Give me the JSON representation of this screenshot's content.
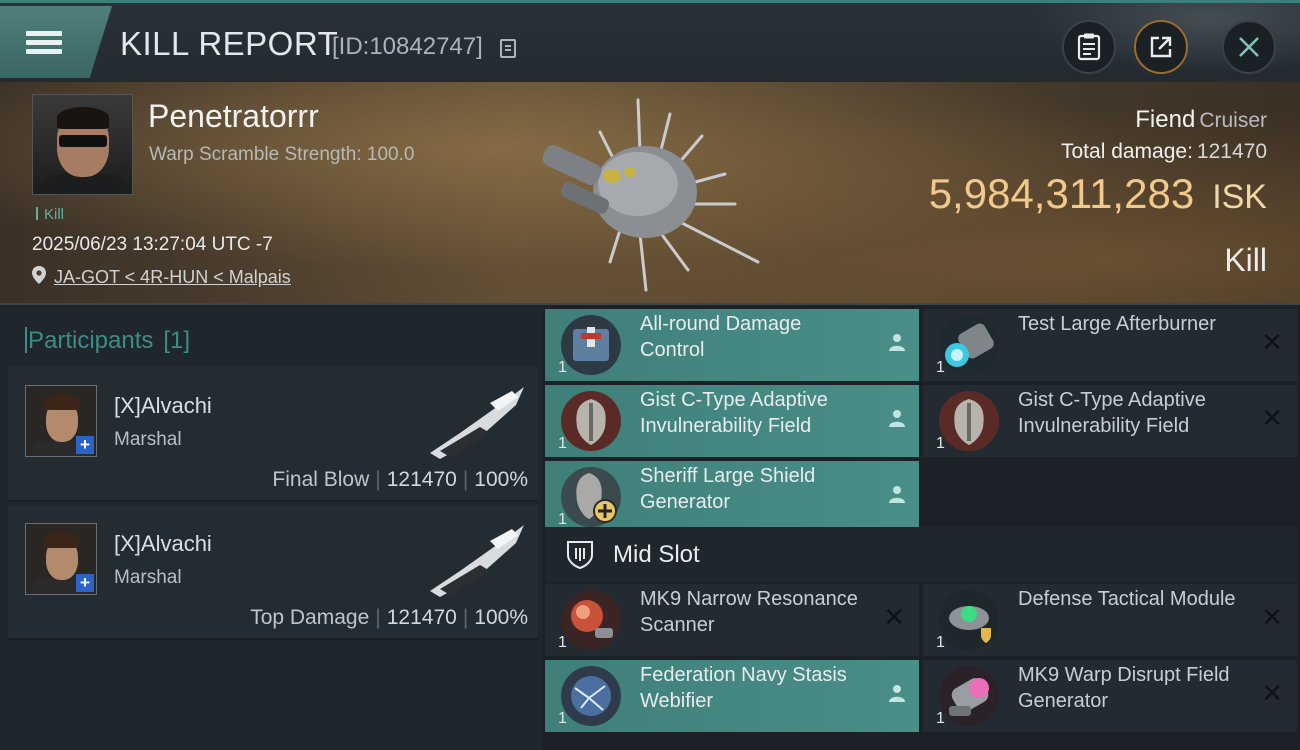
{
  "window": {
    "title": "KILL REPORT",
    "report_id": "[ID:10842747]"
  },
  "victim": {
    "name": "Penetratorrr",
    "warp_scramble": "Warp Scramble Strength: 100.0",
    "kill_tag": "Kill",
    "datetime": "2025/06/23 13:27:04 UTC -7",
    "location": "JA-GOT < 4R-HUN < Malpais",
    "ship_name": "Fiend",
    "ship_class": "Cruiser",
    "total_damage_label": "Total damage:",
    "total_damage": "121470",
    "isk_value": "5,984,311,283",
    "isk_unit": "ISK",
    "result": "Kill"
  },
  "participants": {
    "title": "Participants",
    "count": "[1]",
    "items": [
      {
        "name": "[X]Alvachi",
        "rank": "Marshal",
        "label": "Final Blow",
        "damage": "121470",
        "percent": "100%",
        "sep": "|"
      },
      {
        "name": "[X]Alvachi",
        "rank": "Marshal",
        "label": "Top Damage",
        "damage": "121470",
        "percent": "100%",
        "sep": "|"
      }
    ]
  },
  "modules": {
    "low_left": [
      {
        "name": "All-round Damage Control",
        "qty": "1",
        "state": "active"
      },
      {
        "name": "Gist C-Type Adaptive Invulnerability Field",
        "qty": "1",
        "state": "active"
      },
      {
        "name": "Sheriff Large Shield Generator",
        "qty": "1",
        "state": "active"
      }
    ],
    "low_right": [
      {
        "name": "Test Large Afterburner",
        "qty": "1",
        "state": "destroyed"
      },
      {
        "name": "Gist C-Type Adaptive Invulnerability Field",
        "qty": "1",
        "state": "destroyed"
      }
    ],
    "mid_slot_label": "Mid Slot",
    "mid": [
      {
        "name": "MK9 Narrow Resonance Scanner",
        "qty": "1",
        "state": "destroyed"
      },
      {
        "name": "Defense Tactical Module",
        "qty": "1",
        "state": "destroyed"
      },
      {
        "name": "Federation Navy Stasis Webifier",
        "qty": "1",
        "state": "active"
      },
      {
        "name": "MK9 Warp Disrupt Field Generator",
        "qty": "1",
        "state": "destroyed"
      }
    ]
  },
  "colors": {
    "accent_teal": "#3f8c86",
    "isk_gold": "#f1c98b",
    "active_module": "#4a8e88"
  }
}
